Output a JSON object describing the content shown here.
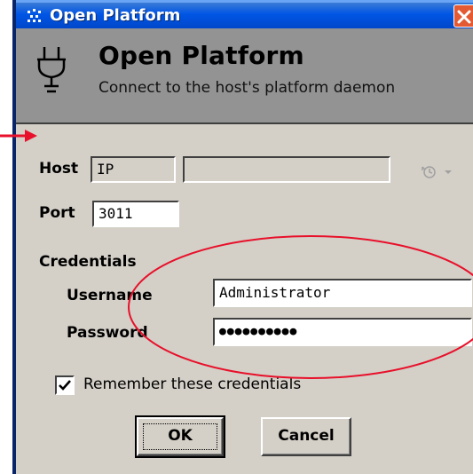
{
  "window": {
    "title": "Open Platform"
  },
  "header": {
    "title": "Open Platform",
    "subtitle": "Connect to the host's platform daemon"
  },
  "form": {
    "host_label": "Host",
    "host_type_value": "IP",
    "host_address_value": "",
    "port_label": "Port",
    "port_value": "3011",
    "credentials_label": "Credentials",
    "username_label": "Username",
    "username_value": "Administrator",
    "password_label": "Password",
    "password_value": "●●●●●●●●●●",
    "remember_label": "Remember these credentials",
    "remember_checked": true
  },
  "buttons": {
    "ok": "OK",
    "cancel": "Cancel"
  },
  "icons": {
    "app": "platform-grid-icon",
    "close": "close-icon",
    "header": "plug-icon",
    "history": "history-clock-icon",
    "checkbox": "checkmark-icon"
  },
  "colors": {
    "titlebar": "#0055e5",
    "close": "#e35a33",
    "header_band": "#939393",
    "dialog_bg": "#d4d0c8",
    "annotation": "#e8102a"
  }
}
